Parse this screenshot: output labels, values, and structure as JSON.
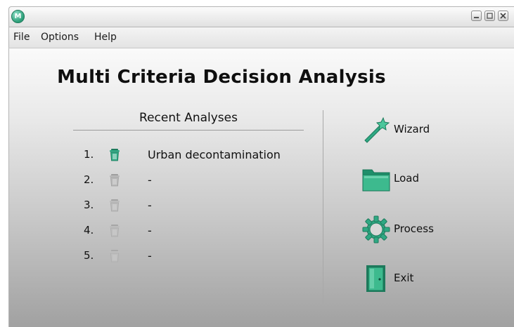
{
  "window": {
    "app_icon_letter": "M",
    "controls": [
      "minimize",
      "maximize",
      "close"
    ]
  },
  "menu": {
    "items": [
      {
        "label": "File"
      },
      {
        "label": "Options"
      },
      {
        "label": "Help"
      }
    ]
  },
  "main": {
    "title": "Multi Criteria Decision Analysis",
    "recent": {
      "heading": "Recent Analyses",
      "items": [
        {
          "number": "1.",
          "name": "Urban decontamination",
          "delete_enabled": true
        },
        {
          "number": "2.",
          "name": "-",
          "delete_enabled": false
        },
        {
          "number": "3.",
          "name": "-",
          "delete_enabled": false
        },
        {
          "number": "4.",
          "name": "-",
          "delete_enabled": false
        },
        {
          "number": "5.",
          "name": "-",
          "delete_enabled": false
        }
      ]
    },
    "actions": [
      {
        "label": "Wizard",
        "icon": "magic-wand-icon"
      },
      {
        "label": "Load",
        "icon": "folder-icon"
      },
      {
        "label": "Process",
        "icon": "gear-icon"
      },
      {
        "label": "Exit",
        "icon": "exit-door-icon"
      }
    ]
  },
  "colors": {
    "accent": "#2fa883",
    "accent_dark": "#1e7a5c",
    "disabled_icon": "#b8b8b8"
  }
}
